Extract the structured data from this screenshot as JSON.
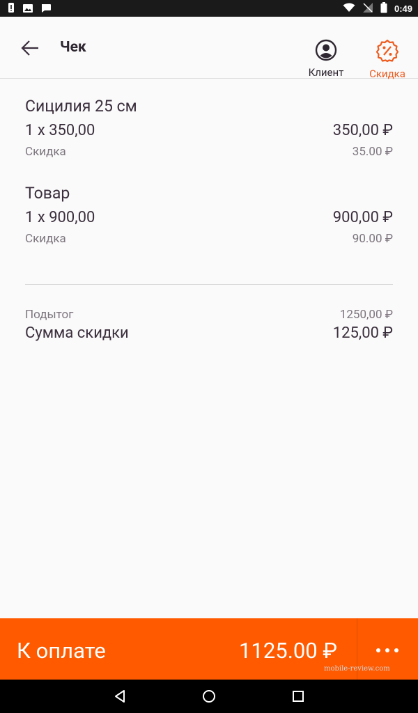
{
  "status_bar": {
    "time": "0:49"
  },
  "header": {
    "title": "Чек",
    "client_label": "Клиент",
    "discount_label": "Скидка"
  },
  "items": [
    {
      "name": "Сицилия 25 см",
      "qty_line": "1 x 350,00",
      "total": "350,00 ₽",
      "discount_label": "Скидка",
      "discount": "35.00 ₽"
    },
    {
      "name": "Товар",
      "qty_line": "1 x 900,00",
      "total": "900,00 ₽",
      "discount_label": "Скидка",
      "discount": "90.00 ₽"
    }
  ],
  "summary": {
    "subtotal_label": "Подытог",
    "subtotal": "1250,00 ₽",
    "discount_sum_label": "Сумма скидки",
    "discount_sum": "125,00 ₽"
  },
  "footer": {
    "pay_label": "К оплате",
    "pay_amount": "1125.00 ₽"
  },
  "watermark": "mobile-review.com",
  "colors": {
    "accent": "#ff5a00",
    "accent_text": "#ee5b1e"
  }
}
